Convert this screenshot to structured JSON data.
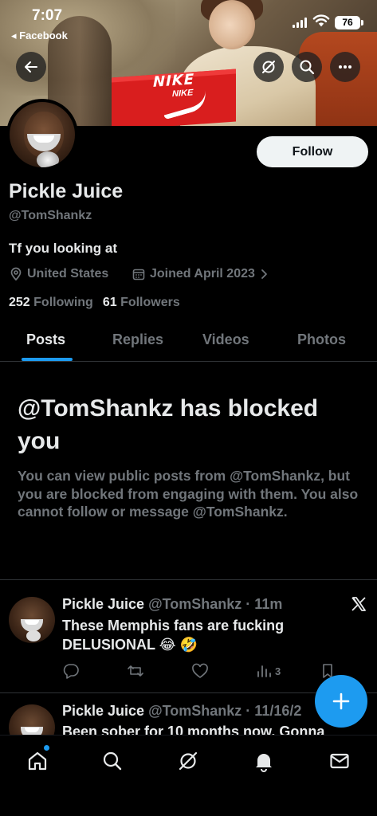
{
  "status_bar": {
    "time": "7:07",
    "back_app": "◂ Facebook",
    "battery": "76"
  },
  "banner": {
    "shoebox_lid_text": "NIKE",
    "shoebox_brand_text": "NIKE"
  },
  "profile": {
    "name": "Pickle Juice",
    "handle": "@TomShankz",
    "bio": "Tf you looking at",
    "location": "United States",
    "joined": "Joined April 2023",
    "following_count": "252",
    "following_label": "Following",
    "followers_count": "61",
    "followers_label": "Followers",
    "follow_label": "Follow"
  },
  "tabs": [
    {
      "label": "Posts",
      "active": true
    },
    {
      "label": "Replies",
      "active": false
    },
    {
      "label": "Videos",
      "active": false
    },
    {
      "label": "Photos",
      "active": false
    }
  ],
  "blocked": {
    "title": "@TomShankz has blocked you",
    "body": "You can view public posts from @TomShankz, but you are blocked from engaging with them. You also cannot follow or message @TomShankz."
  },
  "posts": [
    {
      "name": "Pickle Juice",
      "meta": " @TomShankz · 11m",
      "text": "These Memphis fans are fucking DELUSIONAL 😂 🤣",
      "views": "3"
    },
    {
      "name": "Pickle Juice",
      "meta": " @TomShankz · 11/16/2",
      "text": "Been sober for 10 months now. Gonna"
    }
  ],
  "colors": {
    "accent": "#1d9bf0",
    "background": "#000000",
    "primary_text": "#e7e9ea",
    "secondary_text": "#71767b",
    "border": "#2f3336"
  },
  "icons": {
    "back": "arrow-left-icon",
    "grok": "grok-icon",
    "search": "search-icon",
    "more": "more-icon",
    "location": "location-pin-icon",
    "calendar": "calendar-icon",
    "x_logo": "x-logo-icon",
    "compose": "plus-icon",
    "nav": [
      "home-icon",
      "search-icon",
      "grok-icon",
      "bell-icon",
      "mail-icon"
    ]
  }
}
